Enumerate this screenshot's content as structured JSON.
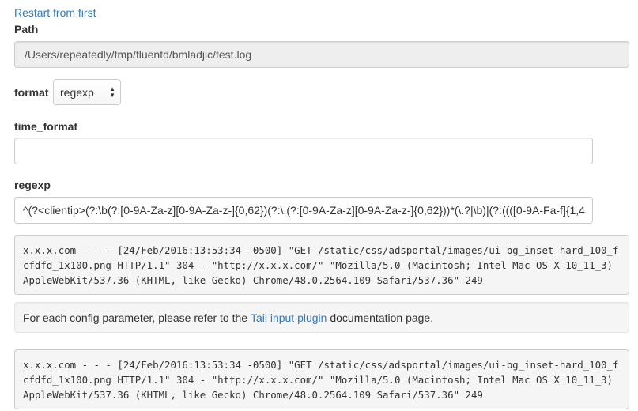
{
  "restart_link": "Restart from first",
  "path": {
    "label": "Path",
    "value": "/Users/repeatedly/tmp/fluentd/bmladjic/test.log"
  },
  "format": {
    "label": "format",
    "selected": "regexp"
  },
  "time_format": {
    "label": "time_format",
    "value": ""
  },
  "regexp": {
    "label": "regexp",
    "value": "^(?<clientip>(?:\\b(?:[0-9A-Za-z][0-9A-Za-z-]{0,62})(?:\\.(?:[0-9A-Za-z][0-9A-Za-z-]{0,62}))*(\\.?|\\b)|(?:((([0-9A-Fa-f]{1,4"
  },
  "log_sample_1": "x.x.x.com - - - [24/Feb/2016:13:53:34 -0500] \"GET /static/css/adsportal/images/ui-bg_inset-hard_100_fcfdfd_1x100.png HTTP/1.1\" 304 - \"http://x.x.x.com/\" \"Mozilla/5.0 (Macintosh; Intel Mac OS X 10_11_3) AppleWebKit/537.36 (KHTML, like Gecko) Chrome/48.0.2564.109 Safari/537.36\" 249",
  "info": {
    "before": "For each config parameter, please refer to the ",
    "link": "Tail input plugin",
    "after": " documentation page."
  },
  "log_sample_2": "x.x.x.com - - - [24/Feb/2016:13:53:34 -0500] \"GET /static/css/adsportal/images/ui-bg_inset-hard_100_fcfdfd_1x100.png HTTP/1.1\" 304 - \"http://x.x.x.com/\" \"Mozilla/5.0 (Macintosh; Intel Mac OS X 10_11_3) AppleWebKit/537.36 (KHTML, like Gecko) Chrome/48.0.2564.109 Safari/537.36\" 249",
  "colors": {
    "link": "#337ab7",
    "text": "#333333",
    "readonly_bg": "#eeeeee",
    "pre_bg": "#f5f5f5"
  }
}
